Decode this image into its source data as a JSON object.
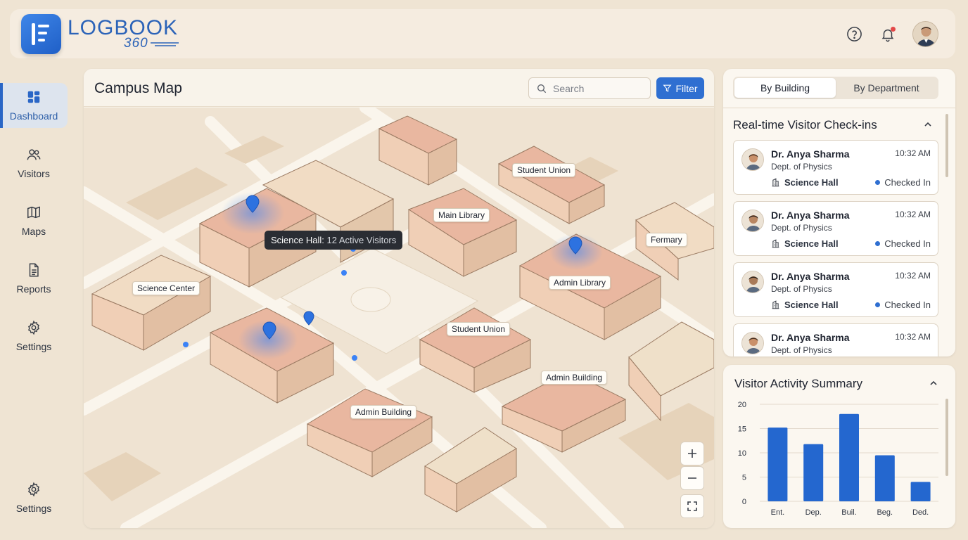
{
  "brand": {
    "name": "LOGBOOK",
    "sub": "360"
  },
  "header": {
    "icons": [
      "help-icon",
      "bell-icon",
      "avatar"
    ]
  },
  "sidebar": {
    "items": [
      {
        "label": "Dashboard",
        "icon": "dashboard-icon",
        "active": true
      },
      {
        "label": "Visitors",
        "icon": "users-icon",
        "active": false
      },
      {
        "label": "Maps",
        "icon": "map-icon",
        "active": false
      },
      {
        "label": "Reports",
        "icon": "document-icon",
        "active": false
      },
      {
        "label": "Settings",
        "icon": "gear-icon",
        "active": false
      }
    ],
    "bottom": {
      "label": "Settings",
      "icon": "gear-icon"
    }
  },
  "map": {
    "title": "Campus Map",
    "search_placeholder": "Search",
    "filter_label": "Filter",
    "tooltip": {
      "building": "Science Hall:",
      "detail": "12 Active Visitors"
    },
    "labels": [
      "Student Union",
      "Main Library",
      "Fermary",
      "Science Center",
      "Admin Library",
      "Student Union",
      "Admin Building",
      "Admin Building"
    ],
    "controls": [
      "zoom-in-icon",
      "zoom-out-icon",
      "fullscreen-icon"
    ]
  },
  "checkins": {
    "tabs": [
      {
        "label": "By Building",
        "active": true
      },
      {
        "label": "By Department",
        "active": false
      }
    ],
    "title": "Real-time Visitor Check-ins",
    "cards": [
      {
        "name": "Dr. Anya Sharma",
        "dept": "Dept. of Physics",
        "time": "10:32 AM",
        "building": "Science Hall",
        "status": "Checked In"
      },
      {
        "name": "Dr. Anya Sharma",
        "dept": "Dept. of Physics",
        "time": "10:32 AM",
        "building": "Science Hall",
        "status": "Checked In"
      },
      {
        "name": "Dr. Anya Sharma",
        "dept": "Dept. of Physics",
        "time": "10:32 AM",
        "building": "Science Hall",
        "status": "Checked In"
      },
      {
        "name": "Dr. Anya Sharma",
        "dept": "Dept. of Physics",
        "time": "10:32 AM",
        "building": "",
        "status": ""
      }
    ]
  },
  "summary": {
    "title": "Visitor Activity Summary"
  },
  "chart_data": {
    "type": "bar",
    "categories": [
      "Ent.",
      "Dep.",
      "Buil.",
      "Beg.",
      "Ded."
    ],
    "values": [
      15.2,
      11.8,
      18,
      9.5,
      4
    ],
    "ylim": [
      0,
      20
    ],
    "yticks": [
      0,
      5,
      10,
      15,
      20
    ],
    "grid": true,
    "colors": {
      "bar": "#2467cf"
    }
  },
  "colors": {
    "accent": "#2f6fd1",
    "background": "#efe4d3",
    "panel": "#fbf7f0"
  }
}
